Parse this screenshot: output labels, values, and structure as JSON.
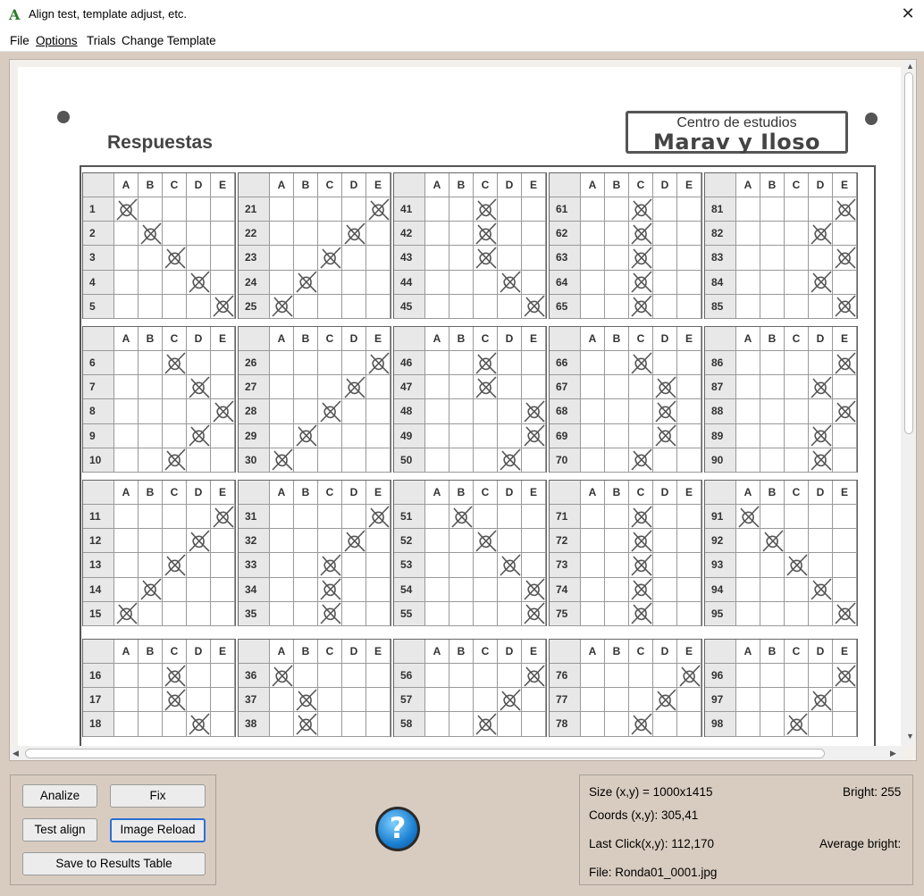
{
  "window": {
    "title": "Align test, template adjust, etc.",
    "app_icon": "A",
    "close_glyph": "✕"
  },
  "menu": {
    "items": [
      {
        "label": "File"
      },
      {
        "label": "Options"
      },
      {
        "label": "Trials"
      },
      {
        "label": "Change Template"
      }
    ]
  },
  "sheet": {
    "title": "Respuestas",
    "logo_line1": "Centro de estudios",
    "logo_line2": "Marav y Iloso",
    "column_letters": [
      "A",
      "B",
      "C",
      "D",
      "E"
    ],
    "rows_of_blocks": [
      [
        [
          1,
          2,
          3,
          4,
          5
        ],
        [
          21,
          22,
          23,
          24,
          25
        ],
        [
          41,
          42,
          43,
          44,
          45
        ],
        [
          61,
          62,
          63,
          64,
          65
        ],
        [
          81,
          82,
          83,
          84,
          85
        ]
      ],
      [
        [
          6,
          7,
          8,
          9,
          10
        ],
        [
          26,
          27,
          28,
          29,
          30
        ],
        [
          46,
          47,
          48,
          49,
          50
        ],
        [
          66,
          67,
          68,
          69,
          70
        ],
        [
          86,
          87,
          88,
          89,
          90
        ]
      ],
      [
        [
          11,
          12,
          13,
          14,
          15
        ],
        [
          31,
          32,
          33,
          34,
          35
        ],
        [
          51,
          52,
          53,
          54,
          55
        ],
        [
          71,
          72,
          73,
          74,
          75
        ],
        [
          91,
          92,
          93,
          94,
          95
        ]
      ],
      [
        [
          16,
          17,
          18
        ],
        [
          36,
          37,
          38
        ],
        [
          56,
          57,
          58
        ],
        [
          76,
          77,
          78
        ],
        [
          96,
          97,
          98
        ]
      ]
    ],
    "marked_answers": {
      "1": "A",
      "2": "B",
      "3": "C",
      "4": "D",
      "5": "E",
      "6": "C",
      "7": "D",
      "8": "E",
      "9": "D",
      "10": "C",
      "11": "E",
      "12": "D",
      "13": "C",
      "14": "B",
      "15": "A",
      "16": "C",
      "17": "C",
      "18": "D",
      "21": "E",
      "22": "D",
      "23": "C",
      "24": "B",
      "25": "A",
      "26": "E",
      "27": "D",
      "28": "C",
      "29": "B",
      "30": "A",
      "31": "E",
      "32": "D",
      "33": "C",
      "34": "C",
      "35": "C",
      "36": "A",
      "37": "B",
      "38": "B",
      "41": "C",
      "42": "C",
      "43": "C",
      "44": "D",
      "45": "E",
      "46": "C",
      "47": "C",
      "48": "E",
      "49": "E",
      "50": "D",
      "51": "B",
      "52": "C",
      "53": "D",
      "54": "E",
      "55": "E",
      "56": "E",
      "57": "D",
      "58": "C",
      "61": "C",
      "62": "C",
      "63": "C",
      "64": "C",
      "65": "C",
      "66": "C",
      "67": "D",
      "68": "D",
      "69": "D",
      "70": "C",
      "71": "C",
      "72": "C",
      "73": "C",
      "74": "C",
      "75": "C",
      "76": "E",
      "77": "D",
      "78": "C",
      "81": "E",
      "82": "D",
      "83": "E",
      "84": "D",
      "85": "E",
      "86": "E",
      "87": "D",
      "88": "E",
      "89": "D",
      "90": "D",
      "91": "A",
      "92": "B",
      "93": "C",
      "94": "D",
      "95": "E",
      "96": "E",
      "97": "D",
      "98": "C"
    }
  },
  "buttons": {
    "analize": "Analize",
    "fix": "Fix",
    "test_align": "Test align",
    "image_reload": "Image Reload",
    "save_results": "Save to Results Table",
    "help_glyph": "?"
  },
  "info": {
    "size": "Size (x,y) = 1000x1415",
    "bright": "Bright: 255",
    "coords": "Coords (x,y): 305,41",
    "last_click": "Last Click(x,y): 112,170",
    "average_bright": "Average bright:",
    "file": "File: Ronda01_0001.jpg"
  },
  "colors": {
    "window_bg": "#d8ccc0",
    "focus_border": "#2c6fd4"
  }
}
